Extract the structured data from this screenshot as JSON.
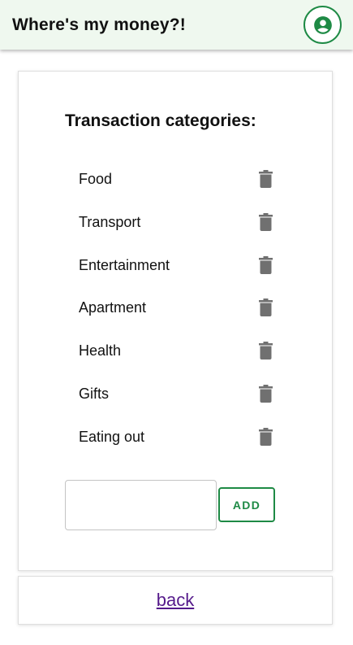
{
  "header": {
    "title": "Where's my money?!",
    "account_icon": "account-circle-icon"
  },
  "categories_card": {
    "title": "Transaction categories:",
    "items": [
      {
        "label": "Food"
      },
      {
        "label": "Transport"
      },
      {
        "label": "Entertainment"
      },
      {
        "label": "Apartment"
      },
      {
        "label": "Health"
      },
      {
        "label": "Gifts"
      },
      {
        "label": "Eating out"
      }
    ],
    "delete_icon": "trash-icon",
    "new_category_value": "",
    "add_label": "ADD"
  },
  "footer": {
    "back_label": "back"
  },
  "colors": {
    "accent": "#1e8a45",
    "header_bg": "#eff8ef",
    "icon_gray": "#707070",
    "link_visited": "#551a8b"
  }
}
